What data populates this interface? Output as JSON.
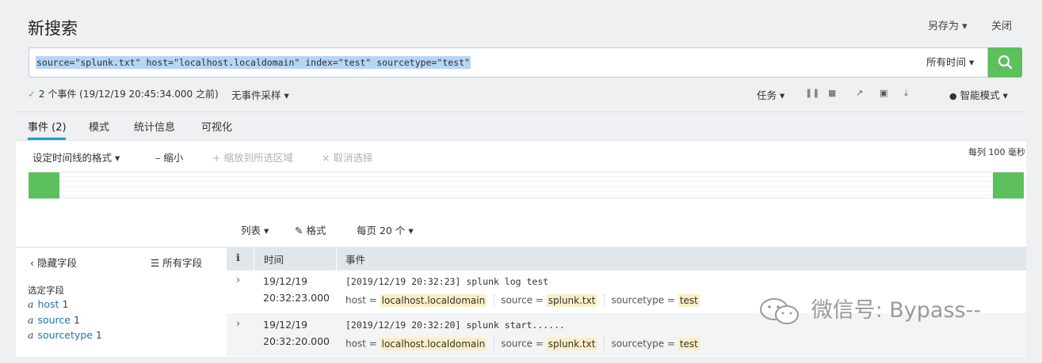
{
  "header": {
    "title": "新搜索",
    "save_as": "另存为 ▾",
    "close": "关闭"
  },
  "search": {
    "query": "source=\"splunk.txt\" host=\"localhost.localdomain\" index=\"test\" sourcetype=\"test\"",
    "time_range": "所有时间 ▾"
  },
  "status": {
    "check_mark": "✓",
    "summary": "2 个事件 (19/12/19 20:45:34.000 之前)",
    "sampling": "无事件采样 ▾",
    "jobs": "任务 ▾",
    "smart_mode": "智能模式 ▾",
    "smart_mode_icon": "lightbulb-icon"
  },
  "tabs": [
    {
      "label": "事件 (2)",
      "active": true
    },
    {
      "label": "模式"
    },
    {
      "label": "统计信息"
    },
    {
      "label": "可视化"
    }
  ],
  "timeline": {
    "format": "设定时间线的格式 ▾",
    "zoom_out": "– 缩小",
    "zoom_to_selection": "+ 缩放到所选区域",
    "deselect": "× 取消选择",
    "scale": "每列 100 毫秒"
  },
  "results_controls": {
    "list": "列表 ▾",
    "format": "✎ 格式",
    "per_page": "每页 20 个 ▾"
  },
  "sidebar": {
    "hide_fields": "‹ 隐藏字段",
    "all_fields": "☰ 所有字段",
    "selected_fields_heading": "选定字段",
    "fields": [
      {
        "type": "a",
        "name": "host",
        "count": "1"
      },
      {
        "type": "a",
        "name": "source",
        "count": "1"
      },
      {
        "type": "a",
        "name": "sourcetype",
        "count": "1"
      }
    ]
  },
  "table": {
    "col_info": "i",
    "col_time": "时间",
    "col_event": "事件",
    "rows": [
      {
        "date": "19/12/19",
        "time": "20:32:23.000",
        "raw": "[2019/12/19 20:32:23]  splunk log test",
        "host_key": "host =",
        "host": "localhost.localdomain",
        "source_key": "source =",
        "source": "splunk.txt",
        "sourcetype_key": "sourcetype =",
        "sourcetype": "test"
      },
      {
        "date": "19/12/19",
        "time": "20:32:20.000",
        "raw": "[2019/12/19 20:32:20]  splunk start......",
        "host_key": "host =",
        "host": "localhost.localdomain",
        "source_key": "source =",
        "source": "splunk.txt",
        "sourcetype_key": "sourcetype =",
        "sourcetype": "test"
      }
    ]
  },
  "watermark": "微信号: Bypass--",
  "colors": {
    "accent_green": "#5cc05c",
    "tab_underline": "#1a9cd8",
    "highlight": "#fbeec5"
  }
}
